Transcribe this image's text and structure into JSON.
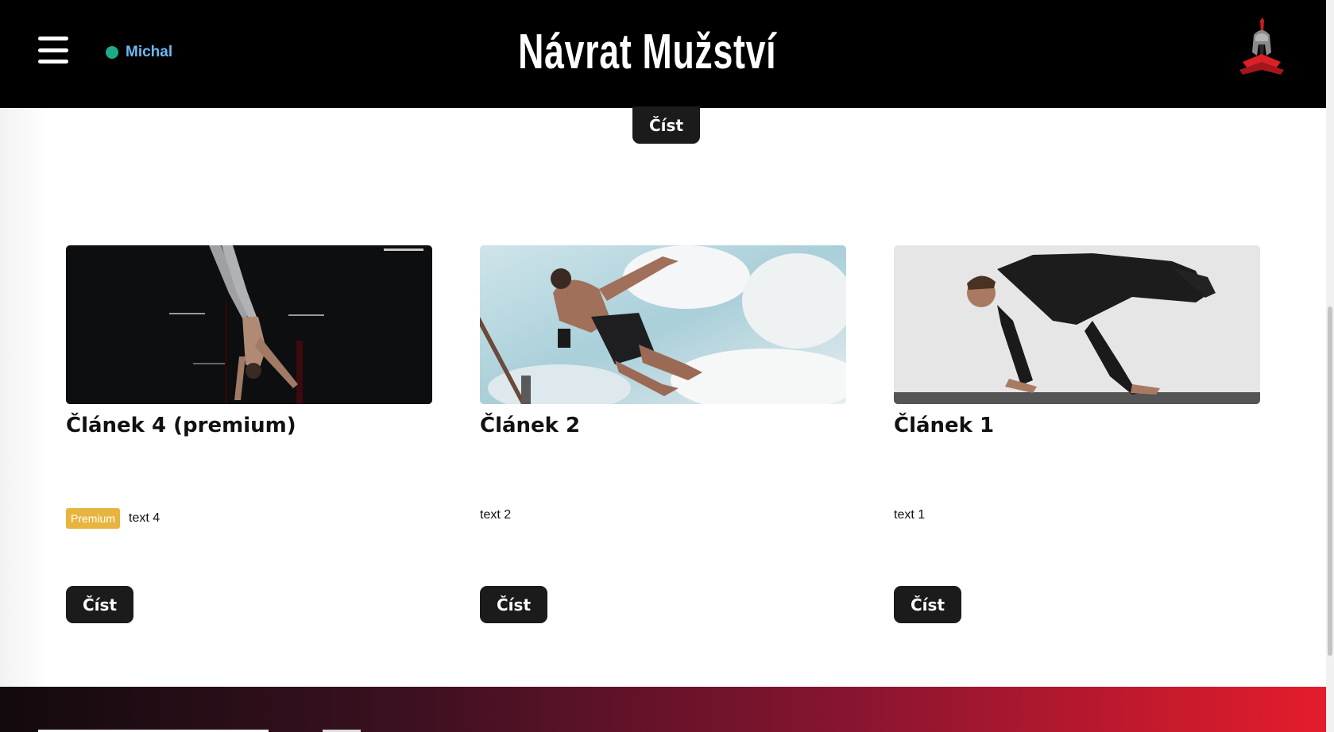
{
  "header": {
    "user_name": "Michal",
    "site_title": "Návrat Mužství",
    "status_color": "#1faa86"
  },
  "icons": {
    "menu": "hamburger-menu-icon",
    "status": "online-status-icon",
    "logo": "spartan-helmet-logo"
  },
  "top_button": {
    "label": "Číst"
  },
  "articles": [
    {
      "title": "Článek 4 (premium)",
      "badge": "Premium",
      "text": "text 4",
      "button": "Číst",
      "image": "man doing handstand in dark gym"
    },
    {
      "title": "Článek 2",
      "badge": "",
      "text": "text 2",
      "button": "Číst",
      "image": "man jumping against cloudy sky"
    },
    {
      "title": "Článek 1",
      "badge": "",
      "text": "text 1",
      "button": "Číst",
      "image": "man doing push-up on mat"
    }
  ],
  "colors": {
    "header_bg": "#000000",
    "button_bg": "#1b1b1b",
    "badge_bg": "#e7b53e",
    "footer_gradient_end": "#e51c2c"
  }
}
